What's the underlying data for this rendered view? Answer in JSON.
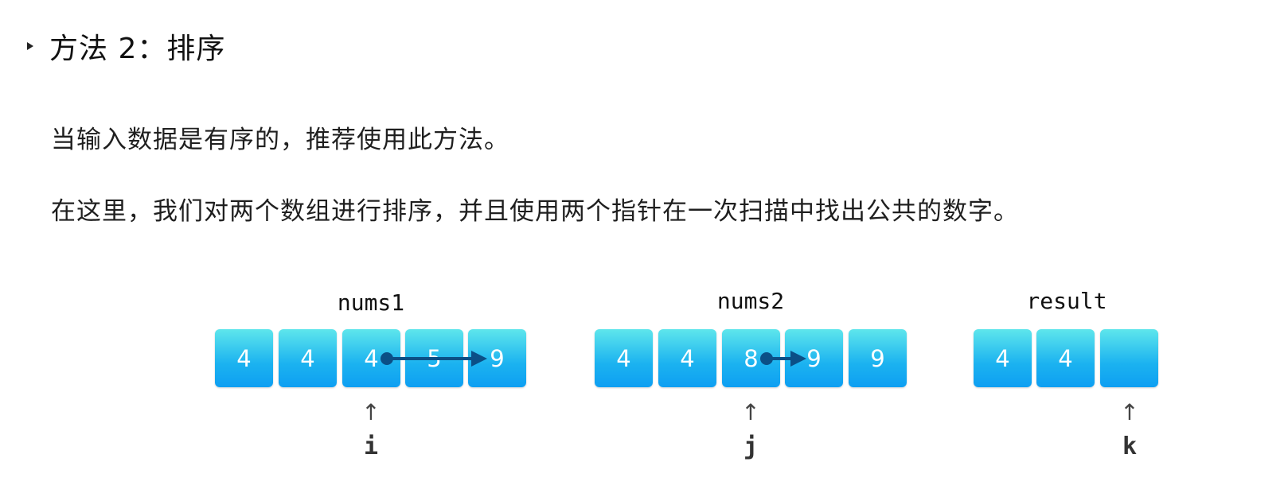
{
  "heading": "方法 2：排序",
  "paragraphs": {
    "p1": "当输入数据是有序的，推荐使用此方法。",
    "p2": "在这里，我们对两个数组进行排序，并且使用两个指针在一次扫描中找出公共的数字。"
  },
  "arrays": {
    "nums1": {
      "label": "nums1",
      "cells": [
        "4",
        "4",
        "4",
        "5",
        "9"
      ]
    },
    "nums2": {
      "label": "nums2",
      "cells": [
        "4",
        "4",
        "8",
        "9",
        "9"
      ]
    },
    "result": {
      "label": "result",
      "cells": [
        "4",
        "4",
        ""
      ]
    }
  },
  "pointers": {
    "i": {
      "label": "i",
      "arrow": "↑"
    },
    "j": {
      "label": "j",
      "arrow": "↑"
    },
    "k": {
      "label": "k",
      "arrow": "↑"
    }
  },
  "colors": {
    "cell_top": "#5ee6ec",
    "cell_bottom": "#0e9ff2",
    "move_arrow": "#0b4f86"
  }
}
